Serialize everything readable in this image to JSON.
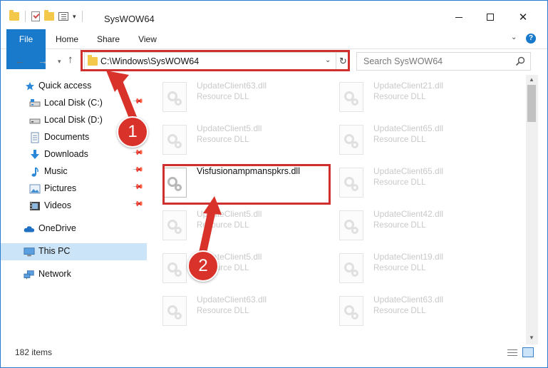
{
  "window": {
    "title": "SysWOW64",
    "min_glyph": "",
    "close_glyph": "✕"
  },
  "ribbon": {
    "tabs": [
      "File",
      "Home",
      "Share",
      "View"
    ],
    "help_glyph": "?"
  },
  "address": {
    "path": "C:\\Windows\\SysWOW64",
    "search_placeholder": "Search SysWOW64"
  },
  "navpane": {
    "items": [
      {
        "label": "Quick access",
        "icon": "star-icon",
        "pinned": false
      },
      {
        "label": "Local Disk (C:)",
        "icon": "drive-icon",
        "pinned": true
      },
      {
        "label": "Local Disk (D:)",
        "icon": "drive-icon",
        "pinned": false
      },
      {
        "label": "Documents",
        "icon": "document-icon",
        "pinned": false
      },
      {
        "label": "Downloads",
        "icon": "download-icon",
        "pinned": true
      },
      {
        "label": "Music",
        "icon": "music-icon",
        "pinned": true
      },
      {
        "label": "Pictures",
        "icon": "picture-icon",
        "pinned": true
      },
      {
        "label": "Videos",
        "icon": "video-icon",
        "pinned": true
      },
      {
        "label": "OneDrive",
        "icon": "cloud-icon",
        "pinned": false
      },
      {
        "label": "This PC",
        "icon": "computer-icon",
        "pinned": false,
        "selected": true
      },
      {
        "label": "Network",
        "icon": "network-icon",
        "pinned": false
      }
    ]
  },
  "files": [
    {
      "name": "UpdateClient63.dll",
      "desc": "Resource DLL",
      "faded": true
    },
    {
      "name": "UpdateClient21.dll",
      "desc": "Resource DLL",
      "faded": true
    },
    {
      "name": "UpdateClient5.dll",
      "desc": "Resource DLL",
      "faded": true
    },
    {
      "name": "UpdateClient65.dll",
      "desc": "Resource DLL",
      "faded": true
    },
    {
      "name": "Visfusionampmanspkrs.dll",
      "desc": "",
      "faded": false
    },
    {
      "name": "UpdateClient65.dll",
      "desc": "Resource DLL",
      "faded": true
    },
    {
      "name": "UpdateClient5.dll",
      "desc": "Resource DLL",
      "faded": true
    },
    {
      "name": "UpdateClient42.dll",
      "desc": "Resource DLL",
      "faded": true
    },
    {
      "name": "UpdateClient5.dll",
      "desc": "Resource DLL",
      "faded": true
    },
    {
      "name": "UpdateClient19.dll",
      "desc": "Resource DLL",
      "faded": true
    },
    {
      "name": "UpdateClient63.dll",
      "desc": "Resource DLL",
      "faded": true
    },
    {
      "name": "UpdateClient63.dll",
      "desc": "Resource DLL",
      "faded": true
    }
  ],
  "status": {
    "item_count": "182 items"
  },
  "annotations": {
    "step1": "1",
    "step2": "2",
    "color": "#d9322a"
  }
}
